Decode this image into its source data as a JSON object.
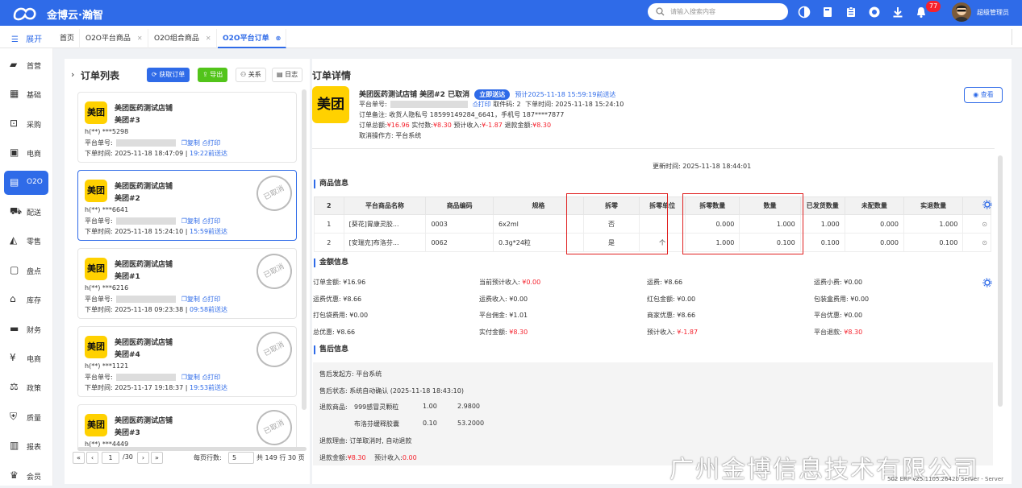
{
  "app": {
    "brand": "金博云·瀚智",
    "search_placeholder": "请输入搜索内容",
    "notification_count": "77",
    "user": "超级管理员"
  },
  "tabs": {
    "expand_label": "展开",
    "items": [
      {
        "label": "首页",
        "closable": false
      },
      {
        "label": "O2O平台商品",
        "closable": true
      },
      {
        "label": "O2O组合商品",
        "closable": true
      },
      {
        "label": "O2O平台订单",
        "closable": true,
        "active": true
      }
    ]
  },
  "sidebar": [
    {
      "label": "首营",
      "icon": "store-icon"
    },
    {
      "label": "基础",
      "icon": "grid-icon"
    },
    {
      "label": "采购",
      "icon": "cart-icon"
    },
    {
      "label": "电商",
      "icon": "shop-icon"
    },
    {
      "label": "O2O",
      "icon": "o2o-icon",
      "active": true
    },
    {
      "label": "配送",
      "icon": "truck-icon"
    },
    {
      "label": "零售",
      "icon": "bag-icon"
    },
    {
      "label": "盘点",
      "icon": "inventory-icon"
    },
    {
      "label": "库存",
      "icon": "warehouse-icon"
    },
    {
      "label": "财务",
      "icon": "finance-icon"
    },
    {
      "label": "电商",
      "icon": "yen-icon"
    },
    {
      "label": "政策",
      "icon": "policy-icon"
    },
    {
      "label": "质量",
      "icon": "shield-icon"
    },
    {
      "label": "报表",
      "icon": "chart-icon"
    },
    {
      "label": "会员",
      "icon": "member-icon"
    }
  ],
  "order_list": {
    "title": "订单列表",
    "buttons": {
      "fetch": "获取订单",
      "export": "导出",
      "relation": "关系",
      "log": "日志"
    },
    "cards": [
      {
        "logo": "美团",
        "store": "美团医药测试店铺",
        "platform": "美团#3",
        "contact": "h(**) ***5298",
        "no_label": "平台单号:",
        "copy": "复制",
        "print": "打印",
        "time_label": "下单时间:",
        "time": "2025-11-18 18:47:09",
        "ago": "19:22前送达",
        "stamp": "",
        "selected": false
      },
      {
        "logo": "美团",
        "store": "美团医药测试店铺",
        "platform": "美团#2",
        "contact": "h(**) ***6641",
        "no_label": "平台单号:",
        "copy": "复制",
        "print": "打印",
        "time_label": "下单时间:",
        "time": "2025-11-18 15:24:10",
        "ago": "15:59前送达",
        "stamp": "已取消",
        "selected": true
      },
      {
        "logo": "美团",
        "store": "美团医药测试店铺",
        "platform": "美团#1",
        "contact": "h(**) ***6216",
        "no_label": "平台单号:",
        "copy": "复制",
        "print": "打印",
        "time_label": "下单时间:",
        "time": "2025-11-18 09:23:38",
        "ago": "09:58前送达",
        "stamp": "已取消",
        "selected": false
      },
      {
        "logo": "美团",
        "store": "美团医药测试店铺",
        "platform": "美团#4",
        "contact": "h(**) ***1121",
        "no_label": "平台单号:",
        "copy": "复制",
        "print": "打印",
        "time_label": "下单时间:",
        "time": "2025-11-17 19:18:37",
        "ago": "19:53前送达",
        "stamp": "已取消",
        "selected": false
      },
      {
        "logo": "美团",
        "store": "美团医药测试店铺",
        "platform": "美团#3",
        "contact": "h(**) ***4449",
        "no_label": "",
        "copy": "",
        "print": "",
        "time_label": "",
        "time": "",
        "ago": "",
        "stamp": "已取消",
        "selected": false
      }
    ],
    "pager": {
      "first": "«",
      "prev": "‹",
      "page": "1",
      "total_pages": "/30",
      "next": "›",
      "last": "»",
      "rows_label": "每页行数:",
      "rows": "5",
      "summary": "共 149 行 30 页"
    }
  },
  "detail": {
    "title": "订单详情",
    "logo": "美团",
    "header": "美团医药测试店铺 美团#2 已取消",
    "badge": "立即送达",
    "eta": "预计2025-11-18 15:59:19前送达",
    "line1": {
      "no_label": "平台单号:",
      "print": "打印",
      "pickup": "取件码: 2",
      "time": "下单时间: 2025-11-18 15:24:10"
    },
    "line2": "订单备注: 收货人隐私号 18599149284_6641，手机号 187****7877",
    "line3": {
      "total_label": "订单总额:",
      "total": "¥16.96",
      "paid_label": "实付数:",
      "paid": "¥8.30",
      "income_label": "预计收入:",
      "income": "¥-1.87",
      "refund_label": "退款金额:",
      "refund": "¥8.30"
    },
    "line4": "取消操作方: 平台系统",
    "view_button": "查看",
    "update_time": "更新时间: 2025-11-18 18:44:01",
    "goods_title": "商品信息",
    "goods_columns": [
      "2",
      "平台商品名称",
      "商品编码",
      "规格",
      "拆零",
      "拆零单位",
      "拆零数量",
      "数量",
      "已发货数量",
      "未配数量",
      "实退数量"
    ],
    "goods_rows": [
      [
        "1",
        "[葵花]胃康灵胶...",
        "0003",
        "6x2ml",
        "否",
        "",
        "0.000",
        "1.000",
        "1.000",
        "0.000",
        "1.000"
      ],
      [
        "2",
        "[安瑞克]布洛芬...",
        "0062",
        "0.3g*24粒",
        "是",
        "个",
        "1.000",
        "0.100",
        "0.100",
        "0.000",
        "0.100"
      ]
    ],
    "amount_title": "金额信息",
    "amounts": [
      [
        "订单金额: ¥16.96",
        "当前预计收入: ¥0.00",
        "运费: ¥8.66",
        "运费小费: ¥0.00"
      ],
      [
        "运费优惠: ¥8.66",
        "运费收入: ¥0.00",
        "红包金额: ¥0.00",
        "包装盒费用: ¥0.00"
      ],
      [
        "打包袋费用: ¥0.00",
        "平台佣金: ¥1.01",
        "商家优惠: ¥8.66",
        "平台优惠: ¥0.00"
      ],
      [
        "总优惠: ¥8.66",
        "实付金额: ¥8.30",
        "预计收入: ¥-1.87",
        "平台退款: ¥8.30"
      ]
    ],
    "aftersale_title": "售后信息",
    "aftersale": {
      "initiator": "售后发起方: 平台系统",
      "status": "售后状态: 系统自动确认 (2025-11-18 18:43:10)",
      "refund_goods_label": "退款商品:",
      "refund_items": [
        {
          "name": "999感冒灵颗粒",
          "qty": "1.00",
          "amount": "2.9800"
        },
        {
          "name": "布洛芬缓释胶囊",
          "qty": "0.10",
          "amount": "53.2000"
        }
      ],
      "reason": "退款理由: 订单取消时, 自动退款",
      "refund_label": "退款金额:",
      "refund": "¥8.30",
      "income_label": "预计收入:",
      "income": "0.00"
    }
  },
  "watermark": "广州金博信息技术有限公司",
  "footer": "502 ERP v25.1105.2642b Server - Server",
  "colors": {
    "primary": "#2f6be8",
    "meituan": "#ffd100",
    "danger": "#f5222d",
    "success": "#52c41a"
  }
}
